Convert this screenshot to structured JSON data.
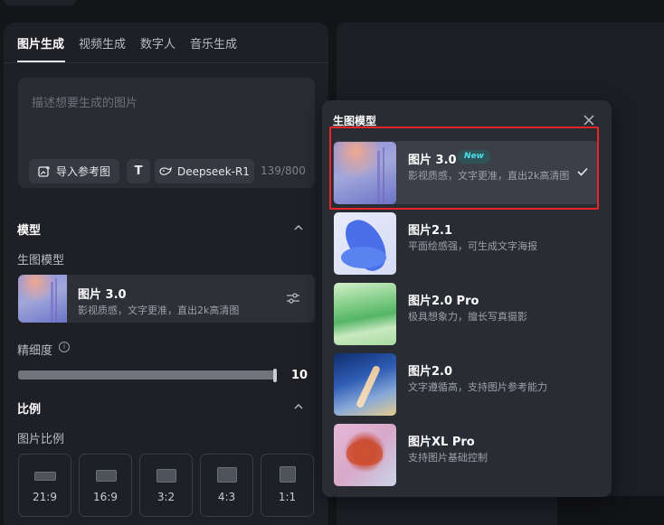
{
  "tabs": [
    {
      "label": "图片生成",
      "active": true
    },
    {
      "label": "视频生成",
      "active": false
    },
    {
      "label": "数字人",
      "active": false
    },
    {
      "label": "音乐生成",
      "active": false
    }
  ],
  "prompt": {
    "placeholder": "描述想要生成的图片",
    "import_ref_label": "导入参考图",
    "text_tool_label": "T",
    "deepseek_label": "Deepseek-R1",
    "char_count": "139/800"
  },
  "model_section": {
    "title": "模型",
    "sub_label": "生图模型",
    "selected": {
      "title": "图片 3.0",
      "desc": "影视质感，文字更准，直出2k高清图"
    }
  },
  "detail": {
    "label": "精细度",
    "info": "i",
    "value": "10",
    "level_fraction": 1.0
  },
  "ratio_section": {
    "title": "比例",
    "sub_label": "图片比例",
    "options": [
      {
        "label": "21:9"
      },
      {
        "label": "16:9"
      },
      {
        "label": "3:2"
      },
      {
        "label": "4:3"
      },
      {
        "label": "1:1"
      }
    ]
  },
  "popup": {
    "title": "生图模型",
    "items": [
      {
        "title": "图片 3.0",
        "badge": "New",
        "desc": "影视质感，文字更准，直出2k高清图",
        "selected": true
      },
      {
        "title": "图片2.1",
        "desc": "平面绘感强，可生成文字海报",
        "selected": false
      },
      {
        "title": "图片2.0 Pro",
        "desc": "极具想象力，擅长写真摄影",
        "selected": false
      },
      {
        "title": "图片2.0",
        "desc": "文字遵循高，支持图片参考能力",
        "selected": false
      },
      {
        "title": "图片XL Pro",
        "desc": "支持图片基础控制",
        "selected": false
      }
    ]
  },
  "colors": {
    "background": "#141519",
    "panel": "#1e2026",
    "popup": "#2a2c33",
    "highlight": "#e8262a",
    "new_badge_text": "#4ee0e6"
  },
  "icons": [
    "image-upload-icon",
    "text-tool-icon",
    "deepseek-whale-icon",
    "chevron-up-icon",
    "adjust-icon",
    "info-icon",
    "close-icon",
    "check-icon"
  ]
}
